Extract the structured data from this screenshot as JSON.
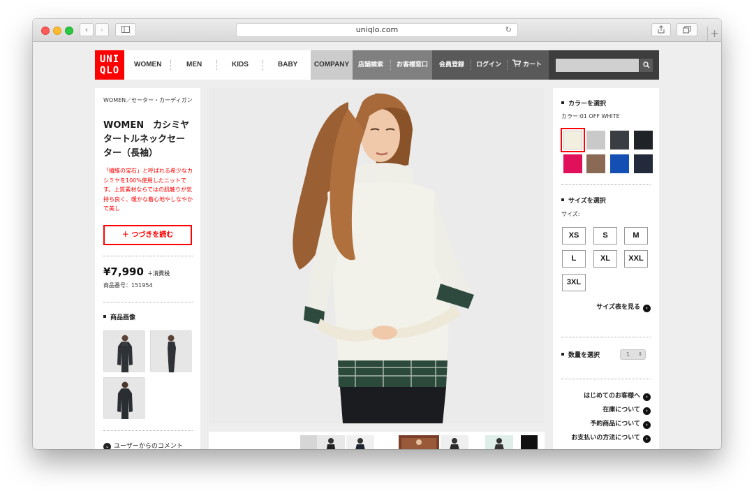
{
  "browser": {
    "url": "uniqlo.com"
  },
  "logo": {
    "line1": "UNI",
    "line2": "QLO"
  },
  "nav": {
    "women": "WOMEN",
    "men": "MEN",
    "kids": "KIDS",
    "baby": "BABY",
    "company": "COMPANY",
    "store_search": "店舗検索",
    "customer_service": "お客様窓口",
    "member_register": "会員登録",
    "login": "ログイン",
    "cart": "カート"
  },
  "product": {
    "breadcrumb": "WOMEN／セーター・カーディガン",
    "title": "WOMEN　カシミヤタートルネックセーター（長袖）",
    "description": "「繊維の宝石」と呼ばれる希少なカシミヤを100%使用したニットです。上質素材ならではの肌触りが気持ち良く、暖かな着心地やしなやかで美し",
    "read_more": "＋ つづきを読む",
    "price": "¥7,990",
    "tax": "＋消費税",
    "product_number": "商品番号：151954",
    "images_heading": "商品画像",
    "user_comments": "ユーザーからのコメント"
  },
  "options": {
    "color_heading": "カラーを選択",
    "color_label": "カラー:01 OFF WHITE",
    "colors": [
      "#f3efe0",
      "#c9c9c9",
      "#3a3d42",
      "#1f2328",
      "#e0105b",
      "#8a6a55",
      "#1450b4",
      "#232a3c"
    ],
    "selected_color_index": 0,
    "size_heading": "サイズを選択",
    "size_label": "サイズ:",
    "sizes": [
      "XS",
      "S",
      "M",
      "L",
      "XL",
      "XXL",
      "3XL"
    ],
    "size_chart": "サイズ表を見る",
    "quantity_heading": "数量を選択",
    "quantity": "1"
  },
  "info_links": [
    "はじめてのお客様へ",
    "在庫について",
    "予約商品について",
    "お支払いの方法について"
  ]
}
